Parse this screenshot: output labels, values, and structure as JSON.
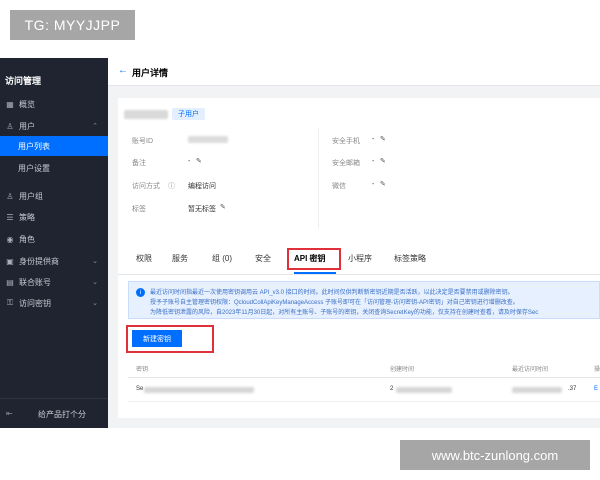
{
  "watermarks": {
    "tg": "TG: MYYJJPP",
    "web": "www.btc-zunlong.com"
  },
  "sidebar": {
    "title": "访问管理",
    "items": [
      {
        "label": "概览",
        "icon": "grid-icon"
      },
      {
        "label": "用户",
        "icon": "user-icon",
        "chevron": "⌃"
      },
      {
        "label": "用户列表",
        "active": true
      },
      {
        "label": "用户设置"
      },
      {
        "label": "用户组",
        "icon": "group-icon"
      },
      {
        "label": "策略",
        "icon": "policy-icon"
      },
      {
        "label": "角色",
        "icon": "role-icon"
      },
      {
        "label": "身份提供商",
        "icon": "idp-icon",
        "chevron": "⌄"
      },
      {
        "label": "联合账号",
        "icon": "federation-icon",
        "chevron": "⌄"
      },
      {
        "label": "访问密钥",
        "icon": "key-icon",
        "chevron": "⌄"
      }
    ],
    "bottom_label": "给产品打个分"
  },
  "header": {
    "back_glyph": "←",
    "title": "用户详情"
  },
  "user_card": {
    "tag": "子用户",
    "fields": [
      {
        "label": "账号ID",
        "value": ""
      },
      {
        "label": "备注",
        "value": "-"
      },
      {
        "label": "访问方式",
        "value": "编程访问"
      },
      {
        "label": "标签",
        "value": "暂无标签"
      },
      {
        "label": "安全手机",
        "value": "-"
      },
      {
        "label": "安全邮箱",
        "value": "-"
      },
      {
        "label": "微信",
        "value": "-"
      }
    ]
  },
  "tabs": [
    "权限",
    "服务",
    "组 (0)",
    "安全",
    "API 密钥",
    "小程序",
    "标签策略"
  ],
  "active_tab": "API 密钥",
  "notice": {
    "lines": [
      "最近访问时间指最近一次使用密钥调用云 API_v3.0 接口的时间。此时间仅供判断新密钥近期是否活跃，以此决定是否要禁用或删除密钥。",
      "授予子账号自主管理密钥权限：QcloudCollApiKeyManageAccess 子账号即可在「访问管理-访问密钥-API密钥」对自己密钥进行增删改查。",
      "为降低密钥泄露的风险，自2023年11月30日起，对所有主账号、子账号的密钥，关闭查询SecretKey的功能，仅支持在创建时查看，请及时保存Sec"
    ]
  },
  "new_key_button": "新建密钥",
  "table": {
    "headers": [
      "密钥",
      "创建时间",
      "最近访问时间",
      "操"
    ],
    "row_partial": [
      "Se",
      "2",
      ".37",
      "E"
    ]
  },
  "colors": {
    "accent": "#006eff",
    "highlight_box": "#e0303a",
    "sidebar_bg": "#1f2430"
  }
}
